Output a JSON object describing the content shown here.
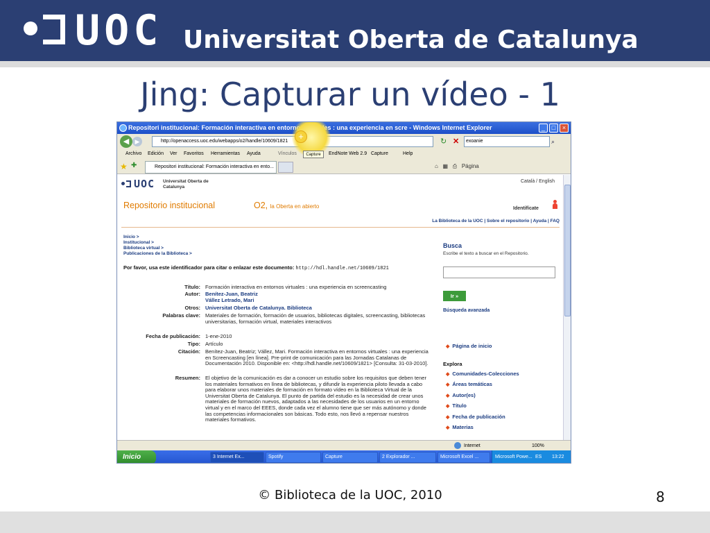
{
  "header": {
    "logo_text": "UOC",
    "university": "Universitat Oberta de Catalunya"
  },
  "slide": {
    "title": "Jing: Capturar un vídeo - 1",
    "footer": "© Biblioteca de la UOC, 2010",
    "page_number": "8"
  },
  "browser": {
    "window_title": "Repositori institucional: Formación interactiva en entornos virtuales : una experiencia en scre - Windows Internet Explorer",
    "address": "http://openaccess.uoc.edu/webapps/o2/handle/10609/1821",
    "search_value": "exoanie",
    "menus": [
      "Archivo",
      "Edición",
      "Ver",
      "Favoritos",
      "Herramientas",
      "Ayuda"
    ],
    "links_label": "Vínculos",
    "endnote": "EndNote Web 2.9",
    "capture_label": "Capture",
    "help_label": "Help",
    "capture_tooltip": "Capture",
    "tab_title": "Repositori institucional: Formación interactiva en ento...",
    "page_menu": "Página",
    "status_zone": "Internet",
    "zoom": "100%"
  },
  "site": {
    "logo_text": "UOC",
    "university": "Universitat Oberta de Catalunya",
    "lang": "Català / English",
    "repo_title": "Repositorio institucional",
    "o2_title": "O2,",
    "o2_subtitle": "la Oberta en abierto",
    "login": "Identifícate",
    "top_links": "La Biblioteca de la UOC  |  Sobre el repositorio  |  Ayuda  |  FAQ",
    "breadcrumbs": [
      "Inicio >",
      "Institucional >",
      "Biblioteca virtual >",
      "Publicaciones de la Biblioteca >"
    ],
    "cite_prompt": "Por favor, usa este identificador para citar o enlazar este documento:",
    "cite_url": "http://hdl.handle.net/10609/1821",
    "metadata": [
      {
        "label": "Título:",
        "value": "Formación interactiva en entornos virtuales : una experiencia en screencasting",
        "link": false
      },
      {
        "label": "Autor:",
        "value": "Benítez-Juan, Beatriz\nVállez Letrado, Mari",
        "link": true
      },
      {
        "label": "Otros:",
        "value": "Universitat Oberta de Catalunya. Biblioteca",
        "link": true
      },
      {
        "label": "Palabras clave:",
        "value": "Materiales de formación, formación de usuarios, bibliotecas digitales, screencasting, bibliotecas universitarias, formación virtual, materiales interactivos",
        "link": false
      },
      {
        "label": "Fecha de publicación:",
        "value": "1-ene-2010",
        "link": false
      },
      {
        "label": "Tipo:",
        "value": "Artículo",
        "link": false
      },
      {
        "label": "Citación:",
        "value": "Benítez-Juan, Beatriz; Vállez, Mari. Formación interactiva en entornos virtuales : una experiencia en Screencasting [en línea]. Pre-print de comunicación para las Jornadas Catalanas de Documentación 2010. Disponible en: <http://hdl.handle.net/10609/1821> [Consulta: 31-03-2010].",
        "link": false
      },
      {
        "label": "Resumen:",
        "value": "El objetivo de la comunicación es dar a conocer un estudio sobre los requisitos que deben tener los materiales formativos en línea de bibliotecas, y difundir la experiencia piloto llevada a cabo para elaborar unos materiales de formación en formato vídeo en la Biblioteca Virtual de la Universitat Oberta de Catalunya. El punto de partida del estudio es la necesidad de crear unos materiales de formación nuevos, adaptados a las necesidades de los usuarios en un entorno virtual y en el marco del EEES, donde cada vez el alumno tiene que ser más autónomo y donde las competencias informacionales son básicas. Todo esto, nos llevó a repensar nuestros materiales formativos.",
        "link": false
      }
    ],
    "search": {
      "heading": "Busca",
      "hint": "Escribe el texto a buscar en el Repositorio.",
      "button": "Ir »",
      "advanced": "Búsqueda avanzada"
    },
    "home_link": "Página de inicio",
    "explore_heading": "Explora",
    "explore_items": [
      "Comunidades-Colecciones",
      "Áreas temáticas",
      "Autor(es)",
      "Título",
      "Fecha de publicación",
      "Materias"
    ]
  },
  "taskbar": {
    "start": "Inicio",
    "tasks": [
      "3 Internet Ex...",
      "Spotify",
      "Capture",
      "2 Explorador ...",
      "Microsoft Excel ...",
      "Microsoft Powe..."
    ],
    "lang": "ES",
    "clock": "13:22"
  },
  "colors": {
    "header_blue": "#2b3f73",
    "orange": "#e07b00",
    "link_blue": "#1a3b80",
    "green_button": "#3d9b3a"
  }
}
